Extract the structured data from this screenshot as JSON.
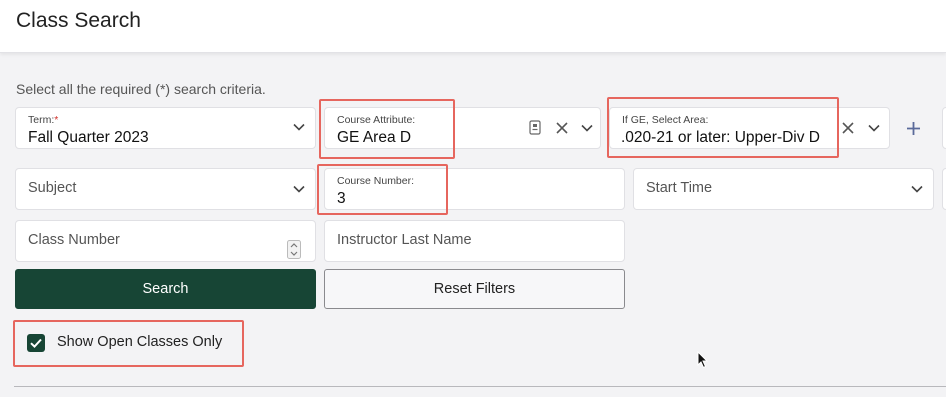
{
  "header": {
    "title": "Class Search"
  },
  "instructions": "Select all the required (*) search criteria.",
  "fields": {
    "term": {
      "label": "Term:",
      "required_mark": "*",
      "value": "Fall Quarter 2023"
    },
    "course_attribute": {
      "label": "Course Attribute:",
      "value": "GE Area D"
    },
    "ge_area": {
      "label": "If GE, Select Area:",
      "value": ".020-21 or later: Upper-Div D"
    },
    "subject": {
      "placeholder": "Subject"
    },
    "course_number": {
      "label": "Course Number:",
      "value": "3"
    },
    "start_time": {
      "placeholder": "Start Time"
    },
    "class_number": {
      "placeholder": "Class Number"
    },
    "instructor_last_name": {
      "placeholder": "Instructor Last Name"
    }
  },
  "buttons": {
    "search": "Search",
    "reset": "Reset Filters"
  },
  "show_open_classes": {
    "label": "Show Open Classes Only",
    "checked": true
  },
  "colors": {
    "primary": "#174535",
    "highlight": "#e6665e",
    "required": "#d0302a"
  },
  "icons": [
    "chevron-down-icon",
    "clear-x-icon",
    "document-icon",
    "plus-icon",
    "spinner-arrows-icon",
    "checkmark-icon",
    "mouse-cursor-icon"
  ]
}
